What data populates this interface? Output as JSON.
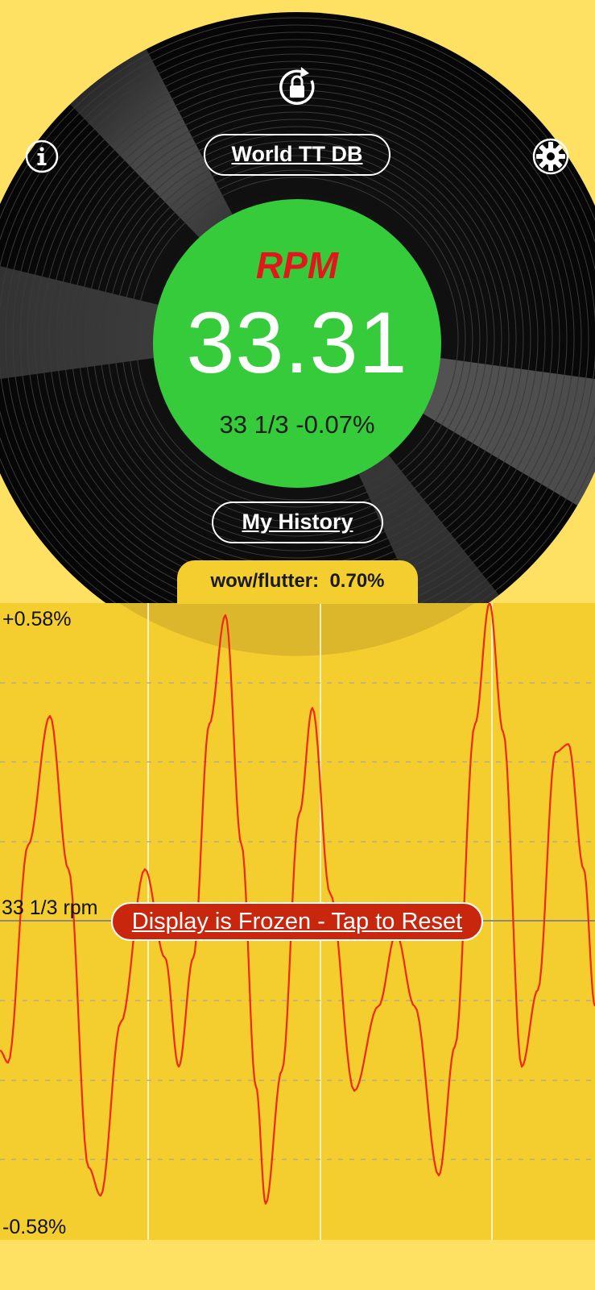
{
  "header": {
    "info_icon": "info-icon",
    "rotation_lock_icon": "rotation-lock-icon",
    "settings_icon": "gear-icon",
    "world_db_label": "World TT DB"
  },
  "readout": {
    "label": "RPM",
    "value": "33.31",
    "subtext": "33 1/3 -0.07%"
  },
  "history_label": "My History",
  "wow_flutter": {
    "label": "wow/flutter:  0.70%"
  },
  "graph": {
    "top_label": "+0.58%",
    "mid_label": "33 1/3 rpm",
    "bottom_label": "-0.58%",
    "frozen_button_label": "Display is Frozen - Tap to Reset"
  },
  "colors": {
    "background": "#FEE063",
    "graph_background": "#F4CD2E",
    "readout_circle": "#36CB3A",
    "rpm_label": "#E2161B",
    "trace": "#F0280D",
    "frozen_button": "#C8260D"
  }
}
